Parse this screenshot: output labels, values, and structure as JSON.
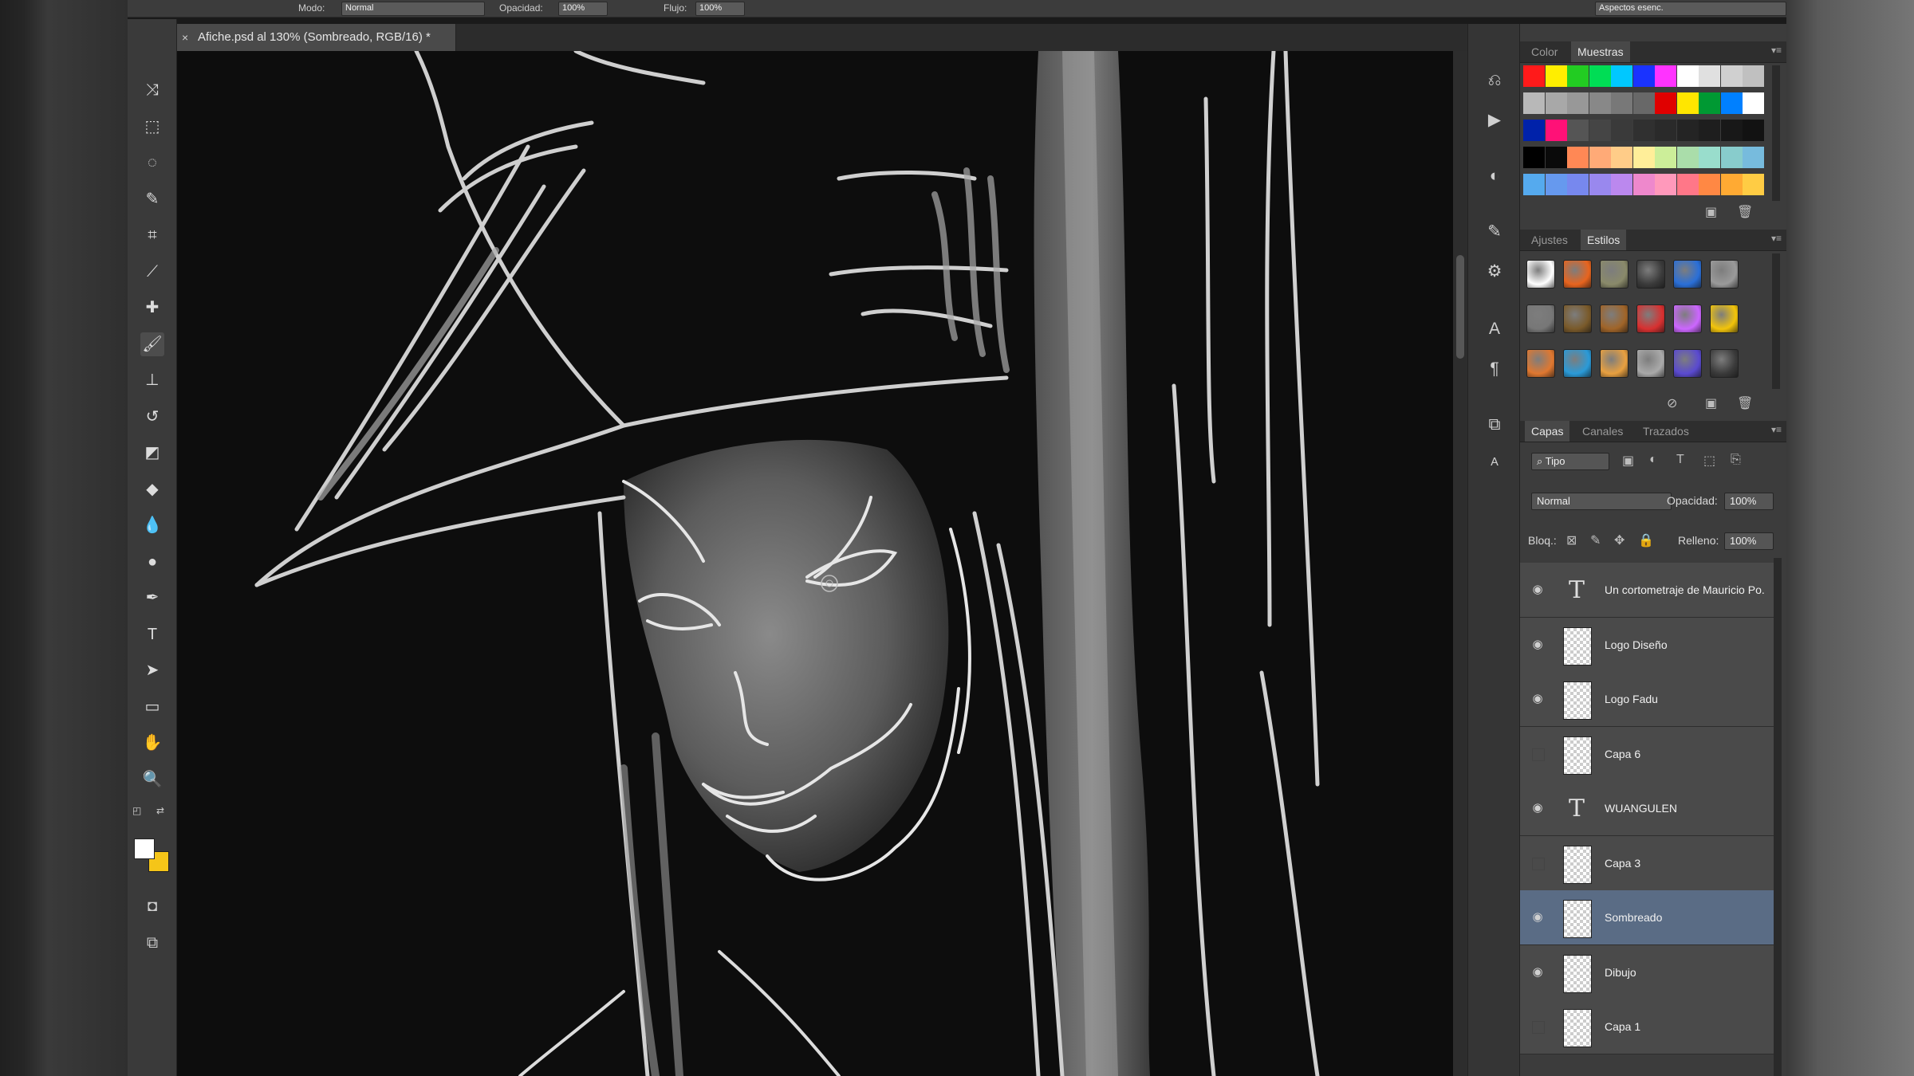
{
  "document": {
    "tab_title": "Afiche.psd al 130% (Sombreado, RGB/16) *",
    "close_glyph": "×"
  },
  "options_bar": {
    "mode_label": "Modo:",
    "mode_value": "Normal",
    "opacity_label": "Opacidad:",
    "opacity_value": "100%",
    "flow_label": "Flujo:",
    "flow_value": "100%",
    "workspace": "Aspectos esenc."
  },
  "tools": [
    {
      "name": "move-tool-icon",
      "glyph": "⤨"
    },
    {
      "name": "marquee-tool-icon",
      "glyph": "⬚"
    },
    {
      "name": "lasso-tool-icon",
      "glyph": "◌"
    },
    {
      "name": "quick-selection-tool-icon",
      "glyph": "✎"
    },
    {
      "name": "crop-tool-icon",
      "glyph": "⌗"
    },
    {
      "name": "eyedropper-tool-icon",
      "glyph": "⟋"
    },
    {
      "name": "healing-brush-tool-icon",
      "glyph": "✚"
    },
    {
      "name": "brush-tool-icon",
      "glyph": "🖌"
    },
    {
      "name": "clone-stamp-tool-icon",
      "glyph": "⊥"
    },
    {
      "name": "history-brush-tool-icon",
      "glyph": "↺"
    },
    {
      "name": "eraser-tool-icon",
      "glyph": "◩"
    },
    {
      "name": "paint-bucket-tool-icon",
      "glyph": "◆"
    },
    {
      "name": "blur-tool-icon",
      "glyph": "💧"
    },
    {
      "name": "dodge-tool-icon",
      "glyph": "●"
    },
    {
      "name": "pen-tool-icon",
      "glyph": "✒"
    },
    {
      "name": "type-tool-icon",
      "glyph": "T"
    },
    {
      "name": "path-selection-tool-icon",
      "glyph": "➤"
    },
    {
      "name": "rectangle-tool-icon",
      "glyph": "▭"
    },
    {
      "name": "hand-tool-icon",
      "glyph": "✋"
    },
    {
      "name": "zoom-tool-icon",
      "glyph": "🔍"
    }
  ],
  "dock_icons": [
    {
      "name": "history-panel-icon",
      "glyph": "⎌"
    },
    {
      "name": "actions-panel-icon",
      "glyph": "▶"
    },
    {
      "name": "adjustments-panel-icon",
      "glyph": "◐"
    },
    {
      "name": "brush-panel-icon",
      "glyph": "✎"
    },
    {
      "name": "tool-presets-icon",
      "glyph": "⚙"
    },
    {
      "name": "character-panel-icon",
      "glyph": "A"
    },
    {
      "name": "paragraph-panel-icon",
      "glyph": "¶"
    },
    {
      "name": "clone-source-icon",
      "glyph": "⧉"
    },
    {
      "name": "character-styles-icon",
      "glyph": "ᴬ"
    }
  ],
  "color_panel": {
    "tabs": [
      "Color",
      "Muestras"
    ],
    "active_tab": 1,
    "swatch_rows": [
      [
        "#ff1a1a",
        "#ffee00",
        "#22cc22",
        "#00dd55",
        "#00c8ff",
        "#1a33ff",
        "#ff33ff",
        "#ffffff",
        "#e0e0e0",
        "#d0d0d0",
        "#c0c0c0"
      ],
      [
        "#b8b8b8",
        "#a8a8a8",
        "#989898",
        "#888888",
        "#787878",
        "#686868",
        "#e00000",
        "#ffe600",
        "#009933",
        "#0080ff",
        "#ffffff"
      ],
      [
        "#0022aa",
        "#ff1177",
        "#555555",
        "#454545",
        "#3a3a3a",
        "#303030",
        "#2a2a2a",
        "#242424",
        "#1e1e1e",
        "#181818",
        "#121212"
      ],
      [
        "#000000",
        "#0a0a0a",
        "#ff8855",
        "#ffaa77",
        "#ffcc88",
        "#ffee99",
        "#ccee99",
        "#aaddaa",
        "#99ddcc",
        "#88cccc",
        "#77bbdd"
      ],
      [
        "#55aaee",
        "#6699ee",
        "#7788ee",
        "#9988ee",
        "#bb88ee",
        "#ee88cc",
        "#ff99bb",
        "#ff7788",
        "#ff8844",
        "#ffaa33",
        "#ffcc44"
      ]
    ]
  },
  "styles_panel": {
    "tabs": [
      "Ajustes",
      "Estilos"
    ],
    "active_tab": 1,
    "styles": [
      [
        "#ffffff",
        "#e8641e",
        "#8a8a6a",
        "#3a3a3a",
        "#2a6fd8",
        "#9a9a9a"
      ],
      [
        "#777777",
        "#7a5a2a",
        "#a06428",
        "#d83030",
        "#cc66ff",
        "#f2c40a"
      ],
      [
        "#e07830",
        "#2a9ad8",
        "#e8a040",
        "#aaaaaa",
        "#5a4ad0",
        "#3a3a3a"
      ]
    ]
  },
  "layers_panel": {
    "tabs": [
      "Capas",
      "Canales",
      "Trazados"
    ],
    "active_tab": 0,
    "filter_label": "Tipo",
    "blend_mode": "Normal",
    "opacity_label": "Opacidad:",
    "opacity_value": "100%",
    "lock_label": "Bloq.:",
    "fill_label": "Relleno:",
    "fill_value": "100%",
    "layers": [
      {
        "name": "Un cortometraje de Mauricio Po...",
        "type": "text",
        "visible": true,
        "selected": false
      },
      {
        "name": "Logo Diseño",
        "type": "raster",
        "visible": true,
        "selected": false
      },
      {
        "name": "Logo Fadu",
        "type": "raster",
        "visible": true,
        "selected": false
      },
      {
        "name": "Capa 6",
        "type": "raster",
        "visible": false,
        "selected": false
      },
      {
        "name": "WUANGULEN",
        "type": "text",
        "visible": true,
        "selected": false
      },
      {
        "name": "Capa 3",
        "type": "raster",
        "visible": false,
        "selected": false
      },
      {
        "name": "Sombreado",
        "type": "raster",
        "visible": true,
        "selected": true
      },
      {
        "name": "Dibujo",
        "type": "raster",
        "visible": true,
        "selected": false
      },
      {
        "name": "Capa 1",
        "type": "raster",
        "visible": false,
        "selected": false
      }
    ]
  },
  "colors": {
    "foreground": "#ffffff",
    "background": "#f5c518",
    "selection": "#5a6c85"
  }
}
